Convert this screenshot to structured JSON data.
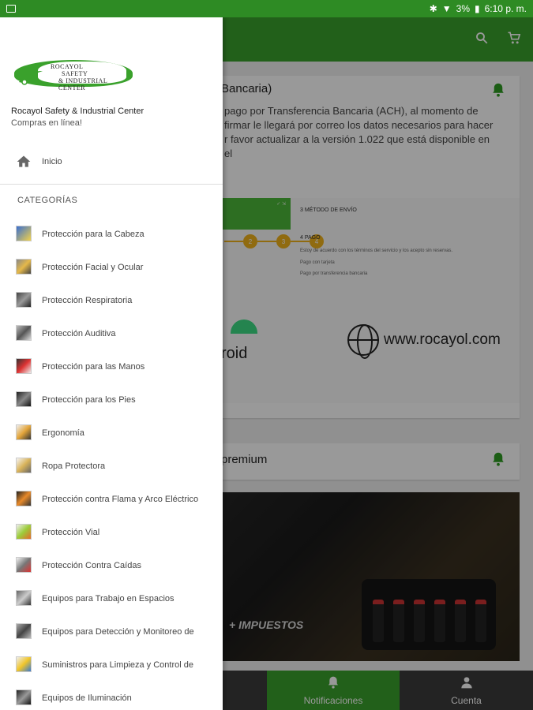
{
  "status_bar": {
    "battery": "3%",
    "time": "6:10 p. m."
  },
  "app_bar": {
    "icons": [
      "search-icon",
      "cart-icon"
    ]
  },
  "background": {
    "card1": {
      "title_fragment": "Bancaria)",
      "text_lines": [
        "pago por Transferencia Bancaria (ACH), al momento de",
        "firmar le llegará por correo los datos necesarios para hacer",
        "r favor actualizar a la versión 1.022 que está disponible en el"
      ],
      "screenshot": {
        "step3": "3 MÉTODO DE ENVÍO",
        "step4": "4 PAGO",
        "terms": "Estoy de acuerdo con los términos del servicio y los acepto sin reservas.",
        "option1": "Pago con tarjeta",
        "option2": "Pago por transferencia bancaria",
        "android_word": "roid",
        "website": "www.rocayol.com"
      }
    },
    "card2": {
      "title_fragment": "premium"
    },
    "banner": {
      "text": "+ IMPUESTOS"
    }
  },
  "bottom_nav": {
    "items": [
      {
        "label": "Notificaciones",
        "icon": "bell-icon"
      },
      {
        "label": "Cuenta",
        "icon": "person-icon"
      }
    ]
  },
  "drawer": {
    "logo_lines": [
      "ROCAYOL",
      "SAFETY",
      "& INDUSTRIAL CENTER"
    ],
    "store_name": "Rocayol Safety & Industrial Center",
    "store_subtitle": "Compras en línea!",
    "home_label": "Inicio",
    "categories_heading": "CATEGORÍAS",
    "categories": [
      "Protección para la Cabeza",
      "Protección Facial y Ocular",
      "Protección Respiratoria",
      "Protección Auditiva",
      "Protección para las Manos",
      "Protección para los Pies",
      "Ergonomía",
      "Ropa Protectora",
      "Protección contra Flama y Arco Eléctrico",
      "Protección Vial",
      "Protección Contra Caídas",
      "Equipos para Trabajo en Espacios",
      "Equipos para Detección y Monitoreo de",
      "Suministros para Limpieza y Control de",
      "Equipos de Iluminación"
    ]
  },
  "colors": {
    "status_bar": "#2e8b24",
    "primary_green": "#3aa12c",
    "bottom_nav": "#3b3b3b"
  }
}
